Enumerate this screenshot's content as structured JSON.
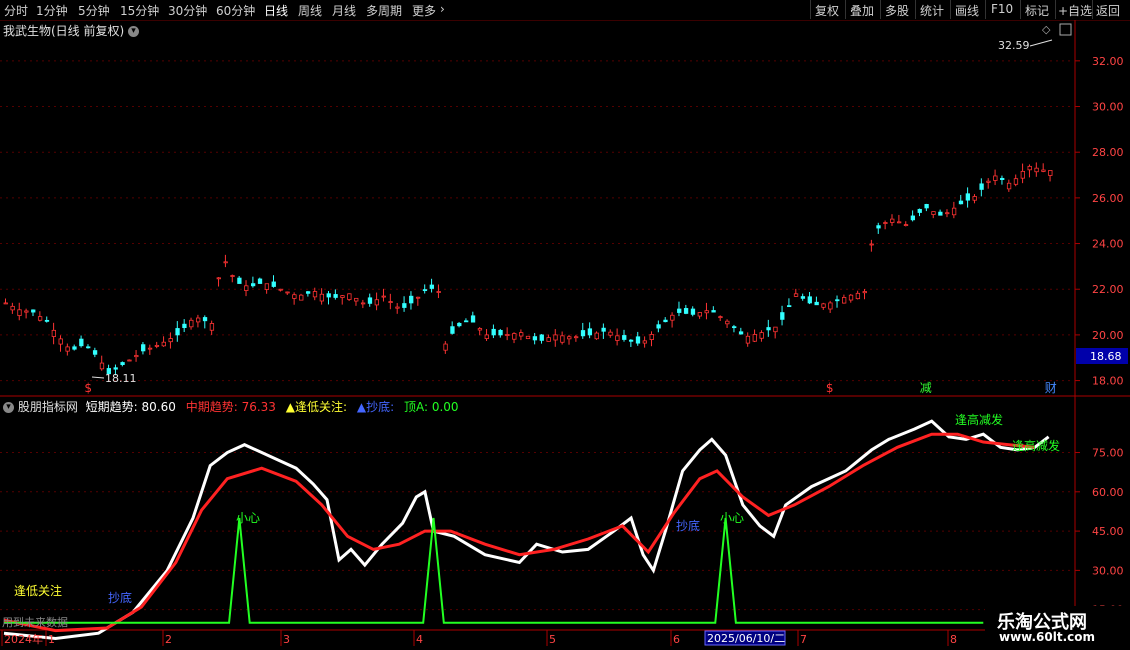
{
  "toolbar": {
    "periods": [
      "分时",
      "1分钟",
      "5分钟",
      "15分钟",
      "30分钟",
      "60分钟",
      "日线",
      "周线",
      "月线",
      "多周期",
      "更多"
    ],
    "selected": "日线",
    "right": [
      "复权",
      "叠加",
      "多股",
      "统计",
      "画线",
      "F10",
      "标记",
      "+自选",
      "返回"
    ]
  },
  "stock_title": "我武生物(日线 前复权)",
  "price_panel": {
    "high_label": "32.59",
    "low_label": "18.11",
    "last_price": "18.68",
    "y_ticks": [
      "32.00",
      "30.00",
      "28.00",
      "26.00",
      "24.00",
      "22.00",
      "20.00",
      "18.00"
    ],
    "markers": [
      {
        "text": "$",
        "color": "#ff3333",
        "date_index": 18
      },
      {
        "text": "$",
        "color": "#ff3333",
        "date_index": 184
      },
      {
        "text": "减",
        "color": "#33ff33",
        "date_index": 205
      },
      {
        "text": "财",
        "color": "#4488ff",
        "date_index": 233
      }
    ]
  },
  "indicator": {
    "name": "股朋指标网",
    "short_label": "短期趋势: 80.60",
    "mid_label": "中期趋势: 76.33",
    "focus_label": "▲逢低关注:",
    "bottom_label": "▲抄底:",
    "top_label": "顶A: 0.00",
    "y_ticks": [
      "75.00",
      "60.00",
      "45.00",
      "30.00",
      "15.00"
    ],
    "annotations": [
      "逢低关注",
      "抄底",
      "小心",
      "抄底",
      "小心",
      "逢高减发",
      "逢高减发"
    ],
    "future_text": "用到未来数据"
  },
  "colors": {
    "up": "#ff3333",
    "down": "#33ffff",
    "short": "#ffffff",
    "mid": "#ff2222",
    "signal": "#22ff22",
    "axis": "#aa0000"
  },
  "x_axis": {
    "labels": [
      "2024年",
      "1",
      "2",
      "3",
      "4",
      "5",
      "6",
      "7",
      "8"
    ],
    "cursor_date": "2025/06/10/二"
  },
  "watermark": {
    "name": "乐淘公式网",
    "url": "www.60lt.com"
  },
  "chart_data": [
    {
      "type": "candlestick",
      "title": "我武生物(日线 前复权)",
      "ylim": [
        17.5,
        33.0
      ],
      "close_path": [
        [
          0,
          21.4
        ],
        [
          8,
          21.1
        ],
        [
          16,
          21.0
        ],
        [
          24,
          20.6
        ],
        [
          30,
          20.0
        ],
        [
          38,
          19.3
        ],
        [
          46,
          19.6
        ],
        [
          54,
          19.0
        ],
        [
          60,
          18.3
        ],
        [
          70,
          18.8
        ],
        [
          80,
          19.3
        ],
        [
          90,
          19.6
        ],
        [
          100,
          20.0
        ],
        [
          110,
          20.8
        ],
        [
          120,
          20.5
        ],
        [
          126,
          23.5
        ],
        [
          134,
          22.3
        ],
        [
          142,
          22.1
        ],
        [
          150,
          22.3
        ],
        [
          160,
          22.0
        ],
        [
          170,
          21.7
        ],
        [
          180,
          21.9
        ],
        [
          190,
          21.6
        ],
        [
          200,
          21.8
        ],
        [
          210,
          21.3
        ],
        [
          220,
          21.7
        ],
        [
          230,
          21.1
        ],
        [
          238,
          21.5
        ],
        [
          246,
          22.1
        ],
        [
          252,
          21.9
        ],
        [
          256,
          19.6
        ],
        [
          262,
          20.3
        ],
        [
          270,
          20.7
        ],
        [
          280,
          20.0
        ],
        [
          290,
          20.0
        ],
        [
          300,
          20.1
        ],
        [
          310,
          19.7
        ],
        [
          320,
          20.0
        ],
        [
          330,
          19.9
        ],
        [
          340,
          20.0
        ],
        [
          350,
          20.2
        ],
        [
          360,
          19.8
        ],
        [
          370,
          19.6
        ],
        [
          380,
          20.3
        ],
        [
          390,
          21.0
        ],
        [
          400,
          20.9
        ],
        [
          410,
          21.1
        ],
        [
          420,
          20.6
        ],
        [
          430,
          19.9
        ],
        [
          440,
          20.1
        ],
        [
          450,
          20.4
        ],
        [
          460,
          21.8
        ],
        [
          470,
          21.3
        ],
        [
          480,
          21.4
        ],
        [
          490,
          21.7
        ],
        [
          500,
          21.9
        ],
        [
          505,
          24.5
        ],
        [
          515,
          25.1
        ],
        [
          525,
          24.8
        ],
        [
          535,
          25.6
        ],
        [
          545,
          25.2
        ],
        [
          555,
          25.7
        ],
        [
          565,
          26.1
        ],
        [
          575,
          27.0
        ],
        [
          585,
          26.6
        ],
        [
          595,
          27.4
        ],
        [
          605,
          27.2
        ]
      ]
    },
    {
      "type": "line",
      "series": [
        {
          "name": "短期趋势",
          "points": [
            [
              0,
              6
            ],
            [
              30,
              4
            ],
            [
              55,
              6
            ],
            [
              75,
              14
            ],
            [
              95,
              30
            ],
            [
              110,
              50
            ],
            [
              120,
              70
            ],
            [
              130,
              75
            ],
            [
              140,
              78
            ],
            [
              150,
              75
            ],
            [
              160,
              72
            ],
            [
              170,
              69
            ],
            [
              180,
              63
            ],
            [
              188,
              57
            ],
            [
              195,
              34
            ],
            [
              202,
              38
            ],
            [
              210,
              32
            ],
            [
              220,
              40
            ],
            [
              232,
              48
            ],
            [
              240,
              58
            ],
            [
              245,
              60
            ],
            [
              250,
              45
            ],
            [
              262,
              43
            ],
            [
              280,
              36
            ],
            [
              300,
              33
            ],
            [
              310,
              40
            ],
            [
              325,
              37
            ],
            [
              340,
              38
            ],
            [
              355,
              45
            ],
            [
              365,
              50
            ],
            [
              372,
              36
            ],
            [
              378,
              30
            ],
            [
              385,
              45
            ],
            [
              395,
              68
            ],
            [
              405,
              76
            ],
            [
              412,
              80
            ],
            [
              420,
              74
            ],
            [
              430,
              55
            ],
            [
              440,
              47
            ],
            [
              448,
              43
            ],
            [
              455,
              55
            ],
            [
              470,
              62
            ],
            [
              490,
              68
            ],
            [
              505,
              76
            ],
            [
              515,
              80
            ],
            [
              530,
              84
            ],
            [
              540,
              87
            ],
            [
              550,
              81
            ],
            [
              560,
              80
            ],
            [
              570,
              82
            ],
            [
              580,
              77
            ],
            [
              590,
              76
            ],
            [
              600,
              77
            ],
            [
              608,
              81
            ]
          ]
        },
        {
          "name": "中期趋势",
          "points": [
            [
              0,
              11
            ],
            [
              30,
              7
            ],
            [
              60,
              8
            ],
            [
              80,
              16
            ],
            [
              100,
              33
            ],
            [
              115,
              53
            ],
            [
              130,
              65
            ],
            [
              150,
              69
            ],
            [
              170,
              64
            ],
            [
              185,
              55
            ],
            [
              200,
              43
            ],
            [
              215,
              38
            ],
            [
              230,
              40
            ],
            [
              245,
              45
            ],
            [
              260,
              45
            ],
            [
              280,
              40
            ],
            [
              300,
              36
            ],
            [
              320,
              38
            ],
            [
              340,
              42
            ],
            [
              360,
              47
            ],
            [
              375,
              37
            ],
            [
              390,
              52
            ],
            [
              405,
              65
            ],
            [
              415,
              68
            ],
            [
              430,
              58
            ],
            [
              445,
              51
            ],
            [
              460,
              55
            ],
            [
              480,
              62
            ],
            [
              500,
              70
            ],
            [
              520,
              77
            ],
            [
              540,
              82
            ],
            [
              555,
              82
            ],
            [
              570,
              79
            ],
            [
              585,
              78
            ],
            [
              600,
              77
            ]
          ]
        },
        {
          "name": "顶A",
          "spikes": [
            137,
            250,
            420
          ],
          "spike_value": 50
        }
      ],
      "ylim": [
        8,
        92
      ]
    }
  ]
}
